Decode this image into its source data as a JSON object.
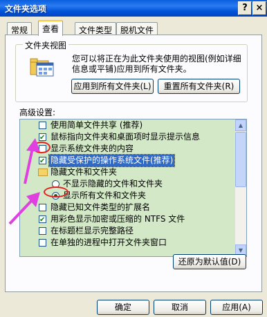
{
  "window": {
    "title": "文件夹选项",
    "help_icon": "?",
    "close_icon": "×"
  },
  "tabs": [
    {
      "label": "常规",
      "active": false
    },
    {
      "label": "查看",
      "active": true
    },
    {
      "label": "文件类型",
      "active": false
    },
    {
      "label": "脱机文件",
      "active": false
    }
  ],
  "folder_views": {
    "legend": "文件夹视图",
    "description": "您可以将正在为此文件夹使用的视图(例如详细信息或平铺)应用到所有文件夹。",
    "apply_all_label": "应用到所有文件夹(L)",
    "reset_all_label": "重置所有文件夹(R)"
  },
  "advanced": {
    "label": "高级设置:",
    "items": [
      {
        "type": "checkbox",
        "checked": false,
        "label": "使用简单文件共享 (推荐)"
      },
      {
        "type": "checkbox",
        "checked": true,
        "label": "鼠标指向文件夹和桌面项时显示提示信息"
      },
      {
        "type": "checkbox",
        "checked": false,
        "label": "显示系统文件夹的内容"
      },
      {
        "type": "checkbox",
        "checked": true,
        "label": "隐藏受保护的操作系统文件(推荐)",
        "selected": true
      },
      {
        "type": "folder",
        "label": "隐藏文件和文件夹"
      },
      {
        "type": "radio",
        "checked": false,
        "label": "不显示隐藏的文件和文件夹"
      },
      {
        "type": "radio",
        "checked": true,
        "label": "显示所有文件和文件夹"
      },
      {
        "type": "checkbox",
        "checked": false,
        "label": "隐藏已知文件类型的扩展名"
      },
      {
        "type": "checkbox",
        "checked": true,
        "label": "用彩色显示加密或压缩的 NTFS 文件"
      },
      {
        "type": "checkbox",
        "checked": false,
        "label": "在标题栏显示完整路径"
      },
      {
        "type": "checkbox",
        "checked": false,
        "label": "在单独的进程中打开文件夹窗口"
      }
    ],
    "restore_defaults_label": "还原为默认值(D)"
  },
  "footer": {
    "ok_label": "确定",
    "cancel_label": "取消",
    "apply_label": "应用(A)"
  },
  "colors": {
    "titlebar": "#0a5fdc",
    "list_bg": "#d2e8c6",
    "selection": "#316ac5",
    "annotation_oval": "#e41e1e",
    "annotation_arrow": "#e040e0"
  },
  "icons": {
    "scroll_up": "up-arrow-icon",
    "scroll_down": "down-arrow-icon",
    "folder_view": "folder-window-icon"
  }
}
